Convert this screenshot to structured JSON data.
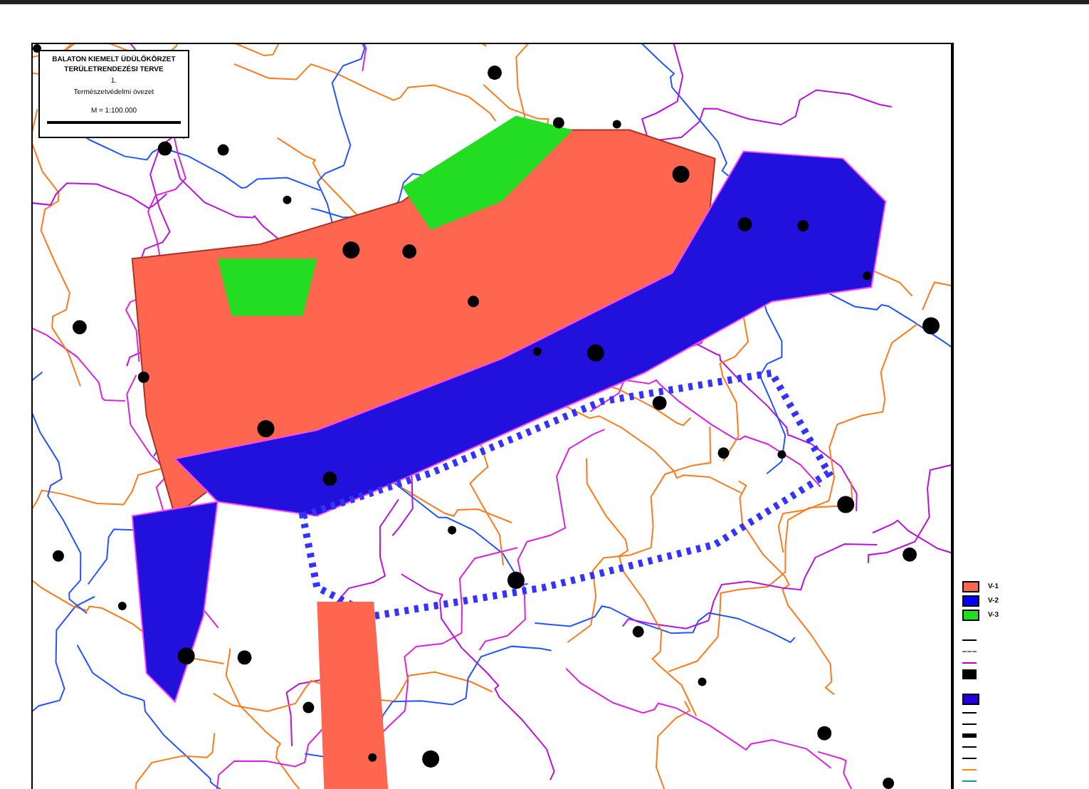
{
  "title_block": {
    "lines": [
      "BALATON KIEMELT ÜDÜLŐKÖRZET",
      "TERÜLETRENDEZÉSI TERVE",
      "1.",
      "Természetvédelmi övezet"
    ],
    "scale": "M = 1:100.000"
  },
  "legend": [
    {
      "kind": "swatch",
      "color": "#ff6650",
      "code": "V-1"
    },
    {
      "kind": "swatch",
      "color": "#0000ff",
      "code": "V-2"
    },
    {
      "kind": "swatch",
      "color": "#22dd22",
      "code": "V-3"
    },
    {
      "kind": "line",
      "color": "#000000"
    },
    {
      "kind": "dash",
      "color": "#777777"
    },
    {
      "kind": "line",
      "color": "#bb00bb"
    },
    {
      "kind": "block",
      "color": "#000000"
    },
    {
      "kind": "swatch",
      "color": "#2200dd"
    },
    {
      "kind": "line",
      "color": "#000000"
    },
    {
      "kind": "line",
      "color": "#000000"
    },
    {
      "kind": "thick",
      "color": "#000000"
    },
    {
      "kind": "line",
      "color": "#000000"
    },
    {
      "kind": "line",
      "color": "#000000"
    },
    {
      "kind": "line",
      "color": "#ff8800"
    },
    {
      "kind": "line",
      "color": "#119999"
    }
  ]
}
